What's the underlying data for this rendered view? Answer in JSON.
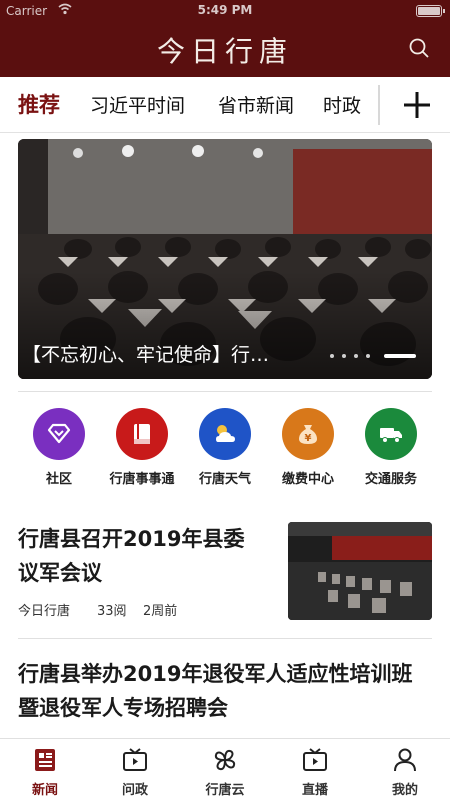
{
  "status_bar": {
    "carrier": "Carrier",
    "time": "5:49 PM"
  },
  "header": {
    "brand": "今日行唐"
  },
  "tabs": [
    {
      "label": "推荐",
      "active": true
    },
    {
      "label": "习近平时间"
    },
    {
      "label": "省市新闻"
    },
    {
      "label": "时政"
    }
  ],
  "banner": {
    "caption": "【不忘初心、牢记使命】行…"
  },
  "services": [
    {
      "label": "社区",
      "color": "#7a2fc0",
      "icon": "diamond-icon"
    },
    {
      "label": "行唐事事通",
      "color": "#c81a1a",
      "icon": "book-icon"
    },
    {
      "label": "行唐天气",
      "color": "#1f54c7",
      "icon": "weather-icon"
    },
    {
      "label": "缴费中心",
      "color": "#d8781a",
      "icon": "yen-bag-icon"
    },
    {
      "label": "交通服务",
      "color": "#1b8a3c",
      "icon": "truck-icon"
    }
  ],
  "news": [
    {
      "title_line1": "行唐县召开2019年县委",
      "title_line2": "议军会议",
      "source": "今日行唐",
      "views": "33阅",
      "time": "2周前"
    },
    {
      "title_line1": "行唐县举办2019年退役军人适应性培训班",
      "title_line2": "暨退役军人专场招聘会"
    }
  ],
  "bottom_nav": [
    {
      "label": "新闻",
      "icon": "news-icon",
      "active": true
    },
    {
      "label": "问政",
      "icon": "tv-icon"
    },
    {
      "label": "行唐云",
      "icon": "clover-icon"
    },
    {
      "label": "直播",
      "icon": "live-icon"
    },
    {
      "label": "我的",
      "icon": "user-icon"
    }
  ],
  "colors": {
    "header_bg": "#5a0f0f",
    "accent": "#7a1212"
  }
}
